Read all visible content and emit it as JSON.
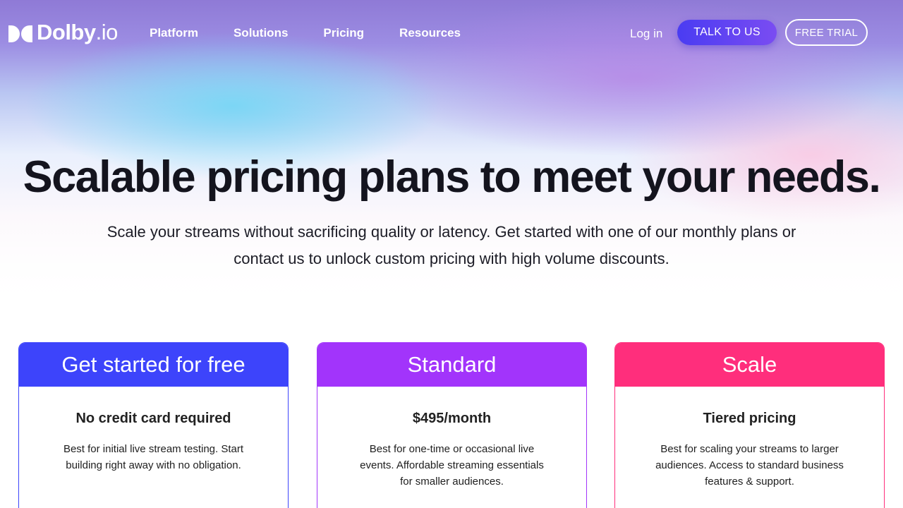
{
  "brand": {
    "name": "Dolby",
    "suffix": ".io",
    "logo_icon": "dolby-double-d-icon"
  },
  "nav": {
    "links": [
      "Platform",
      "Solutions",
      "Pricing",
      "Resources"
    ],
    "login": "Log in",
    "talk_button": "TALK TO US",
    "trial_button": "FREE TRIAL"
  },
  "hero": {
    "title": "Scalable pricing plans to meet your needs.",
    "subtitle": "Scale your streams without sacrificing quality or latency. Get started with one of our monthly plans or contact us to unlock custom pricing with high volume discounts."
  },
  "plans": [
    {
      "name": "Get started for free",
      "price": "No credit card required",
      "description": "Best for initial live stream testing. Start building right away with no obligation.",
      "color": "#3d44fb"
    },
    {
      "name": "Standard",
      "price": "$495/month",
      "description": "Best for one-time or occasional live events. Affordable streaming essentials for smaller audiences.",
      "color": "#a234fb"
    },
    {
      "name": "Scale",
      "price": "Tiered pricing",
      "description": "Best for scaling your streams to larger audiences. Access to standard business features &  support.",
      "color": "#ff2e7c"
    }
  ],
  "colors": {
    "talk_button": "#4a3cf2",
    "heading_text": "#14141e"
  }
}
